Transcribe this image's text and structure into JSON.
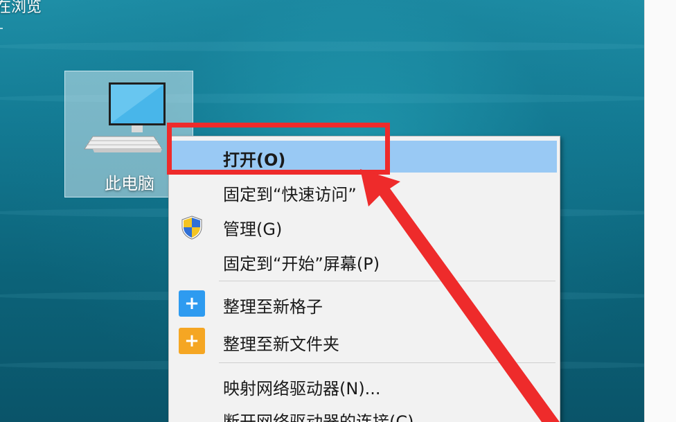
{
  "top_text": "在浏览",
  "desktop_icon": {
    "label": "此电脑",
    "icon": "computer-icon"
  },
  "menu": {
    "open": "打开(O)",
    "pin_quick": "固定到“快速访问”",
    "manage": "管理(G)",
    "pin_start": "固定到“开始”屏幕(P)",
    "tile_group": "整理至新格子",
    "folder_group": "整理至新文件夹",
    "map_drive": "映射网络驱动器(N)...",
    "disconnect_drive": "断开网络驱动器的连接(C)"
  },
  "colors": {
    "highlight": "#99c9f4",
    "annotation_red": "#ee2b2b",
    "tile_blue": "#2e9bf0",
    "tile_orange": "#f5a623"
  }
}
